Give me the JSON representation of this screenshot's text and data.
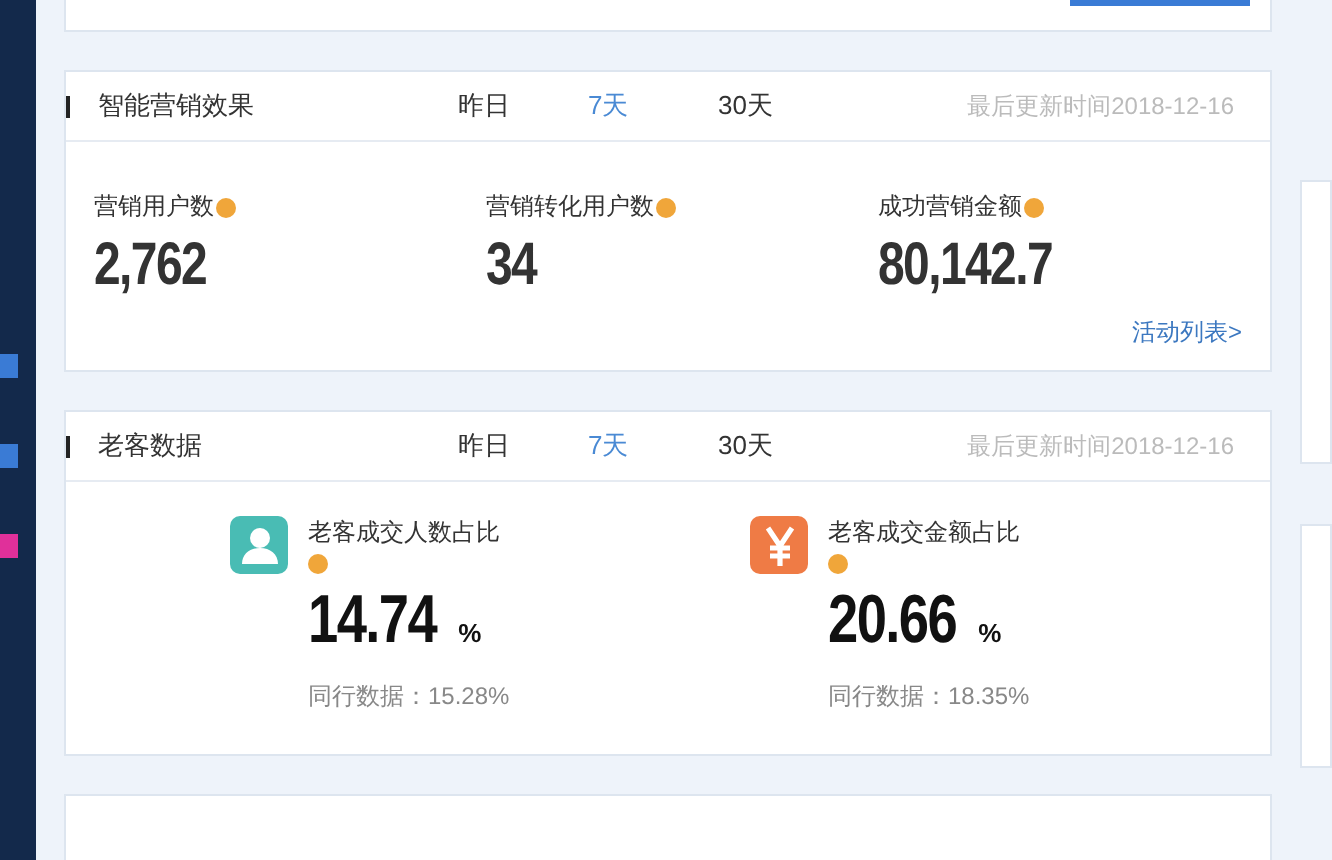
{
  "cards": [
    {
      "title": "智能营销效果",
      "tabs": [
        {
          "label": "昨日",
          "selected": false
        },
        {
          "label": "7天",
          "selected": true
        },
        {
          "label": "30天",
          "selected": false
        }
      ],
      "updated": "最后更新时间2018-12-16",
      "kind": "metrics",
      "metrics": [
        {
          "label": "营销用户数",
          "value": "2,762"
        },
        {
          "label": "营销转化用户数",
          "value": "34"
        },
        {
          "label": "成功营销金额",
          "value": "80,142.7"
        }
      ],
      "link": "活动列表>"
    },
    {
      "title": "老客数据",
      "tabs": [
        {
          "label": "昨日",
          "selected": false
        },
        {
          "label": "7天",
          "selected": true
        },
        {
          "label": "30天",
          "selected": false
        }
      ],
      "updated": "最后更新时间2018-12-16",
      "kind": "ratios",
      "ratios": [
        {
          "kind": "person",
          "label": "老客成交人数占比",
          "value": "14.74",
          "unit": "%",
          "peer": "同行数据：15.28%"
        },
        {
          "kind": "yen",
          "label": "老客成交金额占比",
          "value": "20.66",
          "unit": "%",
          "peer": "同行数据：18.35%"
        }
      ]
    }
  ]
}
